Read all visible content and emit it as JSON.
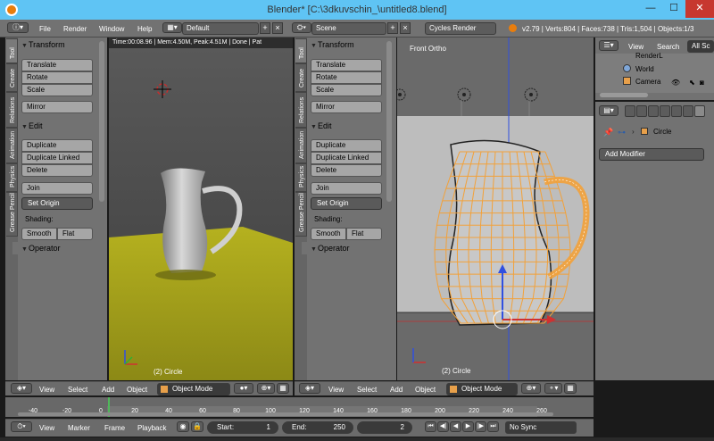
{
  "window": {
    "title": "Blender* [C:\\3dkuvschin_\\untitled8.blend]",
    "min": "—",
    "max": "☐",
    "close": "✕"
  },
  "menu": [
    "File",
    "Render",
    "Window",
    "Help"
  ],
  "layout": "Default",
  "scene": "Scene",
  "engine": "Cycles Render",
  "stats": "v2.79 | Verts:804 | Faces:738 | Tris:1,504 | Objects:1/3",
  "render_info": "Time:00:08.96 | Mem:4.50M, Peak:4.51M | Done | Pat",
  "tabs": [
    "Tool",
    "Create",
    "Relations",
    "Animation",
    "Physics",
    "Grease Pencil"
  ],
  "tool_panel": {
    "transform": "Transform",
    "transform_buttons": [
      "Translate",
      "Rotate",
      "Scale"
    ],
    "mirror": "Mirror",
    "edit": "Edit",
    "edit_buttons": [
      "Duplicate",
      "Duplicate Linked",
      "Delete"
    ],
    "join": "Join",
    "set_origin": "Set Origin",
    "shading": "Shading:",
    "smooth": "Smooth",
    "flat": "Flat",
    "operator": "Operator"
  },
  "viewport_left": {
    "object_label": "(2) Circle"
  },
  "viewport_right": {
    "view_label": "Front Ortho",
    "object_label": "(2) Circle"
  },
  "outliner": {
    "view": "View",
    "search": "Search",
    "all": "All Sc",
    "items": [
      "RenderL",
      "World",
      "Camera"
    ]
  },
  "properties": {
    "object": "Circle",
    "add_modifier": "Add Modifier"
  },
  "vp_header": {
    "view": "View",
    "select": "Select",
    "add": "Add",
    "object": "Object",
    "mode": "Object Mode"
  },
  "timeline": {
    "ticks": [
      "-40",
      "-20",
      "0",
      "20",
      "40",
      "60",
      "80",
      "100",
      "120",
      "140",
      "160",
      "180",
      "200",
      "220",
      "240",
      "260"
    ],
    "current": 1,
    "view": "View",
    "marker": "Marker",
    "frame": "Frame",
    "playback": "Playback",
    "start_label": "Start:",
    "start": "1",
    "end_label": "End:",
    "end": "250",
    "frame_num": "2",
    "sync": "No Sync"
  },
  "colors": {
    "accent": "#5fc4f4",
    "selected": "#f2a13a",
    "floor": "#9e9a1a"
  }
}
